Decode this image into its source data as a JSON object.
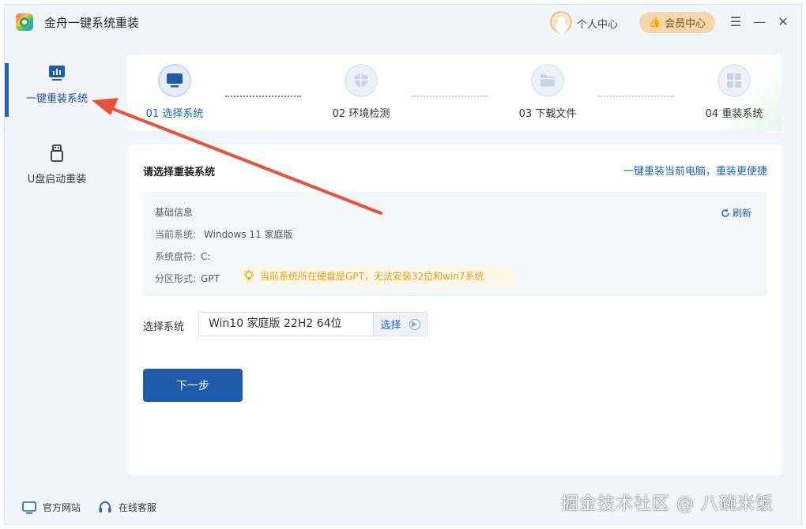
{
  "app": {
    "title": "金舟一键系统重装"
  },
  "header": {
    "personal_center": "个人中心",
    "vip_center": "会员中心"
  },
  "sidebar": {
    "items": [
      {
        "label": "一键重装系统",
        "icon": "monitor-chart-icon",
        "active": true
      },
      {
        "label": "U盘启动重装",
        "icon": "usb-drive-icon",
        "active": false
      }
    ],
    "footer": {
      "website": "官方网站",
      "support": "在线客服"
    }
  },
  "steps": [
    {
      "label": "01 选择系统",
      "icon": "monitor-icon",
      "active": true
    },
    {
      "label": "02 环境检测",
      "icon": "shield-icon",
      "active": false
    },
    {
      "label": "03 下载文件",
      "icon": "folder-icon",
      "active": false
    },
    {
      "label": "04 重装系统",
      "icon": "windows-grid-icon",
      "active": false
    }
  ],
  "main": {
    "title": "请选择重装系统",
    "quick_link": "一键重装当前电脑，重装更便捷",
    "info": {
      "heading": "基础信息",
      "refresh": "刷新",
      "current_system_label": "当前系统:",
      "current_system": "Windows 11 家庭版",
      "system_drive_label": "系统盘符:",
      "system_drive": "C:",
      "partition_label": "分区形式:",
      "partition": "GPT",
      "warning": "当前系统所在硬盘是GPT，无法安装32位和win7系统"
    },
    "select": {
      "label": "选择系统",
      "value": "Win10 家庭版 22H2 64位",
      "button": "选择"
    },
    "next_button": "下一步"
  },
  "watermark": "掘金技术社区 @ 八碗米饭",
  "colors": {
    "accent": "#1e63b8",
    "primary_button": "#1e5bab",
    "warning": "#e6a01c",
    "annotation_arrow": "#e8513a"
  }
}
